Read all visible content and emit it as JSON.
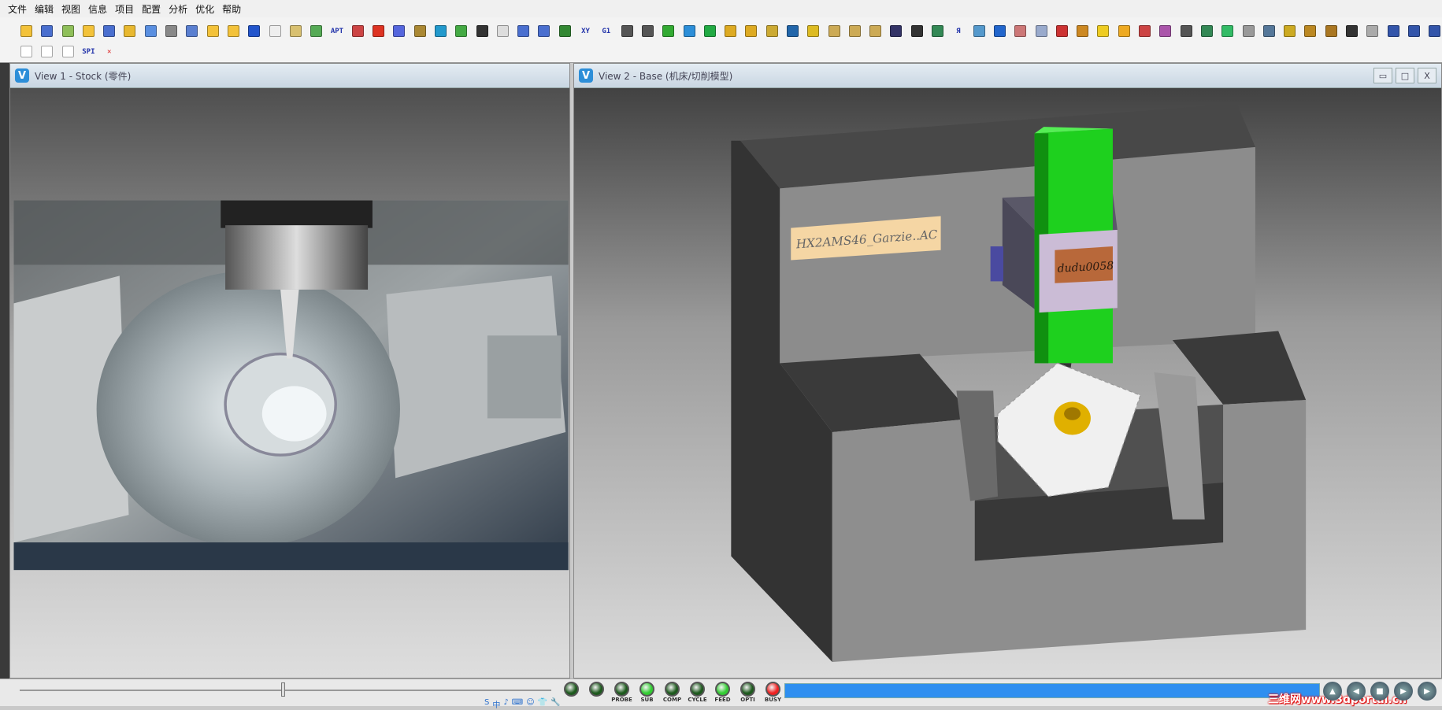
{
  "menu": [
    "文件",
    "编辑",
    "视图",
    "信息",
    "项目",
    "配置",
    "分析",
    "优化",
    "帮助"
  ],
  "toolbar": {
    "row1": [
      {
        "icon": "open-vc-icon",
        "color": "#f3c23a"
      },
      {
        "icon": "save-vc-icon",
        "color": "#4a6fcf"
      },
      {
        "icon": "mch-file-icon",
        "color": "#8fbf5a"
      },
      {
        "icon": "open-ip-icon",
        "color": "#f3c23a"
      },
      {
        "icon": "save-ip-icon",
        "color": "#4a6fcf"
      },
      {
        "icon": "import-icon",
        "color": "#e8b830"
      },
      {
        "icon": "nc-file-icon",
        "color": "#5a8fe0"
      },
      {
        "icon": "machine-file-icon",
        "color": "#888888"
      },
      {
        "icon": "save-file-icon",
        "color": "#5a7fd0"
      },
      {
        "icon": "open-m-icon",
        "color": "#f3c23a"
      },
      {
        "icon": "open-c-icon",
        "color": "#f3c23a"
      },
      {
        "icon": "bulb-icon",
        "color": "#2255cc"
      },
      {
        "icon": "login-icon",
        "color": "#eeeeee"
      },
      {
        "icon": "machine-icon",
        "color": "#d8c070"
      },
      {
        "icon": "pc-icon",
        "color": "#55aa55"
      },
      {
        "icon": "apt-icon",
        "text": "APT"
      },
      {
        "icon": "report-icon",
        "color": "#cc4444"
      },
      {
        "icon": "tool-icon",
        "color": "#dd3322"
      },
      {
        "icon": "disk-icon",
        "color": "#5566dd"
      },
      {
        "icon": "swap-icon",
        "color": "#aa8833"
      },
      {
        "icon": "heart-icon",
        "color": "#2299cc"
      },
      {
        "icon": "list-icon",
        "color": "#44aa44"
      },
      {
        "icon": "fixture-icon",
        "color": "#333333"
      },
      {
        "icon": "target-icon",
        "color": "#dddddd"
      },
      {
        "icon": "save-m-icon",
        "color": "#4a6fcf"
      },
      {
        "icon": "save-g-icon",
        "color": "#4a6fcf"
      },
      {
        "icon": "arrows-icon",
        "color": "#338833"
      },
      {
        "icon": "xyz-icon",
        "text": "XY"
      },
      {
        "icon": "g1-icon",
        "text": "G1"
      },
      {
        "icon": "notes-icon",
        "color": "#555555"
      },
      {
        "icon": "cut-icon",
        "color": "#555555"
      },
      {
        "icon": "check-icon",
        "color": "#33aa33"
      },
      {
        "icon": "vericut-icon",
        "color": "#2c8ed8"
      },
      {
        "icon": "add-icon",
        "color": "#22aa44"
      },
      {
        "icon": "diamond-icon",
        "color": "#ddaa22"
      },
      {
        "icon": "stock-icon",
        "color": "#ddaa22"
      },
      {
        "icon": "measure-icon",
        "color": "#ccaa33"
      },
      {
        "icon": "book-icon",
        "color": "#2266aa"
      },
      {
        "icon": "color-icon",
        "color": "#ddbb22"
      },
      {
        "icon": "zoom-icon",
        "color": "#ccaa55"
      },
      {
        "icon": "zoom-in-icon",
        "color": "#ccaa55"
      },
      {
        "icon": "zoom-out-icon",
        "color": "#ccaa55"
      },
      {
        "icon": "fit-icon",
        "color": "#333366"
      },
      {
        "icon": "eye-icon",
        "color": "#333333"
      },
      {
        "icon": "rotate-icon",
        "color": "#338855"
      },
      {
        "icon": "reverse-icon",
        "text": "Я"
      },
      {
        "icon": "info-doc-icon",
        "color": "#5599cc"
      },
      {
        "icon": "info-icon",
        "color": "#2266cc"
      },
      {
        "icon": "graph-icon",
        "color": "#cc7777"
      },
      {
        "icon": "copy-icon",
        "color": "#99aacc"
      },
      {
        "icon": "delete-icon",
        "color": "#cc3333"
      },
      {
        "icon": "optimize-icon",
        "color": "#cc8822"
      },
      {
        "icon": "lightning-icon",
        "color": "#eecc22"
      },
      {
        "icon": "cube-icon",
        "color": "#eeaa22"
      },
      {
        "icon": "paint-icon",
        "color": "#cc4444"
      },
      {
        "icon": "pattern-icon",
        "color": "#aa55aa"
      },
      {
        "icon": "camera-icon",
        "color": "#555555"
      },
      {
        "icon": "network-icon",
        "color": "#338855"
      },
      {
        "icon": "ruler-icon",
        "color": "#33bb66"
      },
      {
        "icon": "print-icon",
        "color": "#999999"
      },
      {
        "icon": "tool-x-icon",
        "color": "#557799"
      },
      {
        "icon": "spin-icon",
        "color": "#ccaa22"
      },
      {
        "icon": "reset-icon",
        "color": "#bb8822"
      },
      {
        "icon": "settings-icon",
        "color": "#aa7722"
      },
      {
        "icon": "move-icon",
        "color": "#333333"
      },
      {
        "icon": "refresh-icon",
        "color": "#aaaaaa"
      },
      {
        "icon": "single-view-icon",
        "color": "#3355aa"
      },
      {
        "icon": "split-view-icon",
        "color": "#3355aa"
      },
      {
        "icon": "layout-icon",
        "color": "#3355aa"
      }
    ],
    "row2": [
      {
        "icon": "layout-left-icon",
        "color": "#ffffff"
      },
      {
        "icon": "layout-top-icon",
        "color": "#ffffff"
      },
      {
        "icon": "layout-grid-icon",
        "color": "#ffffff"
      },
      {
        "icon": "spi-icon",
        "text": "SPI"
      },
      {
        "icon": "close-icon",
        "text": "✕",
        "textColor": "#dd2222"
      }
    ]
  },
  "views": [
    {
      "logo": "V",
      "title": "View 1 - Stock (零件)"
    },
    {
      "logo": "V",
      "title": "View 2 - Base (机床/切削模型)",
      "buttons": [
        {
          "icon": "minimize-icon",
          "glyph": "▭"
        },
        {
          "icon": "maximize-icon",
          "glyph": "□"
        },
        {
          "icon": "close-icon",
          "glyph": "X"
        }
      ]
    }
  ],
  "scene": {
    "machine_label": "HX2AMS46_Garzie..AC",
    "head_label": "dudu0058",
    "colors": {
      "spindle": "#1ed01e",
      "housing_front": "#8c8c8c",
      "housing_dark": "#3c3c3c",
      "head": "#cbbcd6",
      "label": "#f5d6a4",
      "head_label": "#b8683a",
      "workpiece": "#f0f0f0",
      "tool_holder": "#e0b000"
    }
  },
  "statusbar": {
    "leds": [
      {
        "label": "",
        "state": "off",
        "color": "#1e5a1e"
      },
      {
        "label": "",
        "state": "off",
        "color": "#1e5a1e"
      },
      {
        "label": "PROBE",
        "state": "off",
        "color": "#1e5a1e"
      },
      {
        "label": "SUB",
        "state": "on",
        "color": "#33cc33"
      },
      {
        "label": "COMP",
        "state": "off",
        "color": "#1e5a1e"
      },
      {
        "label": "CYCLE",
        "state": "off",
        "color": "#1e5a1e"
      },
      {
        "label": "FEED",
        "state": "on",
        "color": "#33cc33"
      },
      {
        "label": "OPTI",
        "state": "off",
        "color": "#1e5a1e"
      },
      {
        "label": "BUSY",
        "state": "on",
        "color": "#ee2222"
      }
    ],
    "progress_percent": 100,
    "controls": [
      {
        "icon": "rewind-icon",
        "glyph": "▲"
      },
      {
        "icon": "step-icon",
        "glyph": "◀"
      },
      {
        "icon": "stop-icon",
        "glyph": "■"
      },
      {
        "icon": "step-play-icon",
        "glyph": "▶"
      },
      {
        "icon": "play-icon",
        "glyph": "▶"
      }
    ],
    "ime": [
      "S",
      "中",
      "♪",
      "⌨",
      "☺",
      "👕",
      "🔧"
    ],
    "watermark": "三维网www.3dportal.cn"
  }
}
